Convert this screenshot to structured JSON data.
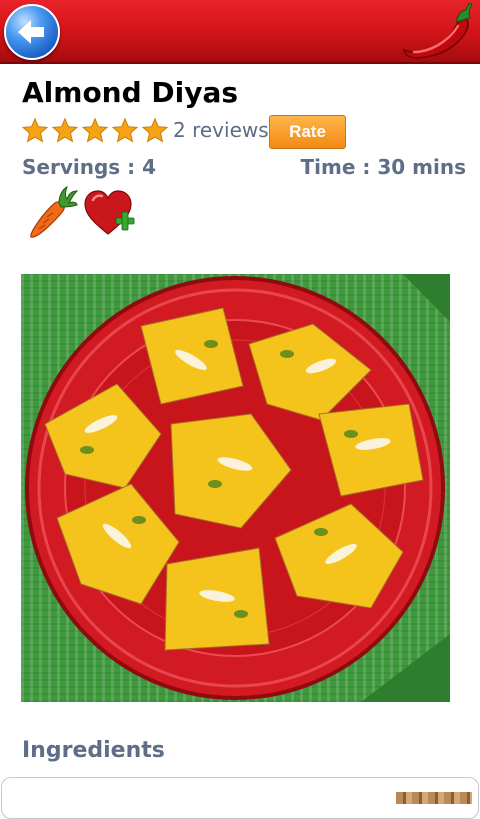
{
  "header": {
    "back_icon": "back-arrow-icon",
    "logo_icon": "chili-pepper-icon",
    "bar_color": "#d01418"
  },
  "recipe": {
    "title": "Almond Diyas",
    "rating": {
      "stars": 5,
      "max": 5,
      "reviews_text": "2 reviews"
    },
    "rate_label": "Rate",
    "servings": "Servings : 4",
    "time": "Time : 30 mins",
    "diet_icon": "carrot-icon",
    "favorite_icon": "heart-plus-icon",
    "photo_alt": "Almond Diyas"
  },
  "ingredients": {
    "heading": "Ingredients"
  },
  "colors": {
    "accent_orange": "#f28a12",
    "label_gray": "#5e6e87",
    "star": "#f5a315"
  }
}
